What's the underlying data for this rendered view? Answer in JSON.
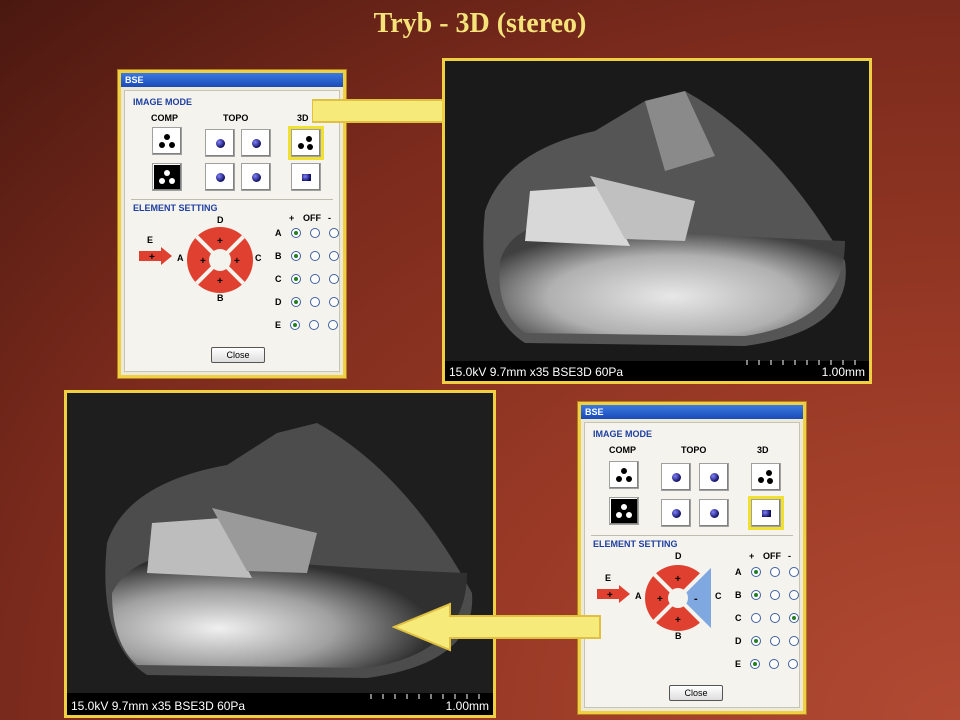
{
  "slide": {
    "title": "Tryb - 3D (stereo)"
  },
  "dialog": {
    "title": "BSE",
    "image_mode": "IMAGE MODE",
    "col_comp": "COMP",
    "col_topo": "TOPO",
    "col_3d": "3D",
    "element_setting": "ELEMENT SETTING",
    "rad_plus": "+",
    "rad_off": "OFF",
    "rad_minus": "-",
    "labels": {
      "e": "E",
      "a": "A",
      "b": "B",
      "c": "C",
      "d": "D"
    },
    "rows": [
      "A",
      "B",
      "C",
      "D",
      "E"
    ],
    "close": "Close",
    "pad_plus": "+",
    "pad_minus": "-"
  },
  "top": {
    "rows_state": [
      "+",
      "+",
      "+",
      "+",
      "+"
    ],
    "selected_mode": "3D-top"
  },
  "bottom": {
    "rows_state": [
      "+",
      "+",
      "-",
      "+",
      "+"
    ],
    "selected_mode": "3D-bottom"
  },
  "sem": {
    "caption": "15.0kV 9.7mm x35 BSE3D 60Pa",
    "scale": "1.00mm"
  },
  "colors": {
    "highlight": "#f0d040",
    "arrow": "#f5ea7a",
    "pad_red": "#e04030",
    "pad_blue": "#80a8e0"
  }
}
